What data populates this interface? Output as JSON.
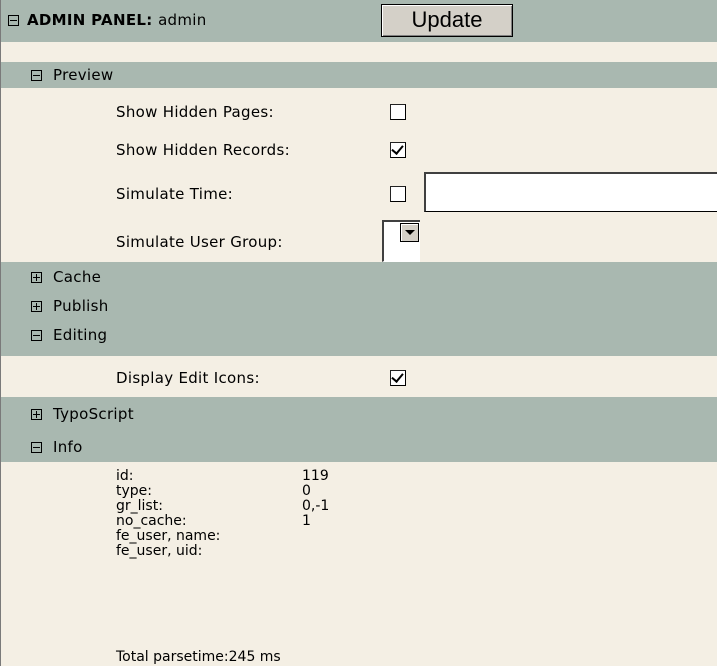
{
  "header": {
    "title_bold": "ADMIN PANEL:",
    "title_user": "admin",
    "update_label": "Update"
  },
  "sections": {
    "preview": {
      "label": "Preview",
      "show_hidden_pages": {
        "label": "Show Hidden Pages:",
        "checked": false
      },
      "show_hidden_records": {
        "label": "Show Hidden Records:",
        "checked": true
      },
      "simulate_time": {
        "label": "Simulate Time:",
        "checked": false,
        "value": ""
      },
      "simulate_user_group": {
        "label": "Simulate User Group:",
        "value": ""
      }
    },
    "cache": {
      "label": "Cache"
    },
    "publish": {
      "label": "Publish"
    },
    "editing": {
      "label": "Editing",
      "display_edit_icons": {
        "label": "Display Edit Icons:",
        "checked": true
      }
    },
    "typoscript": {
      "label": "TypoScript"
    },
    "info": {
      "label": "Info",
      "rows": [
        {
          "key": "id:",
          "value": "119"
        },
        {
          "key": "type:",
          "value": "0"
        },
        {
          "key": "gr_list:",
          "value": "0,-1"
        },
        {
          "key": "no_cache:",
          "value": "1"
        },
        {
          "key": "fe_user, name:",
          "value": ""
        },
        {
          "key": "fe_user, uid:",
          "value": ""
        }
      ],
      "parsetime_label": "Total parsetime:",
      "parsetime_value": "245 ms"
    }
  }
}
